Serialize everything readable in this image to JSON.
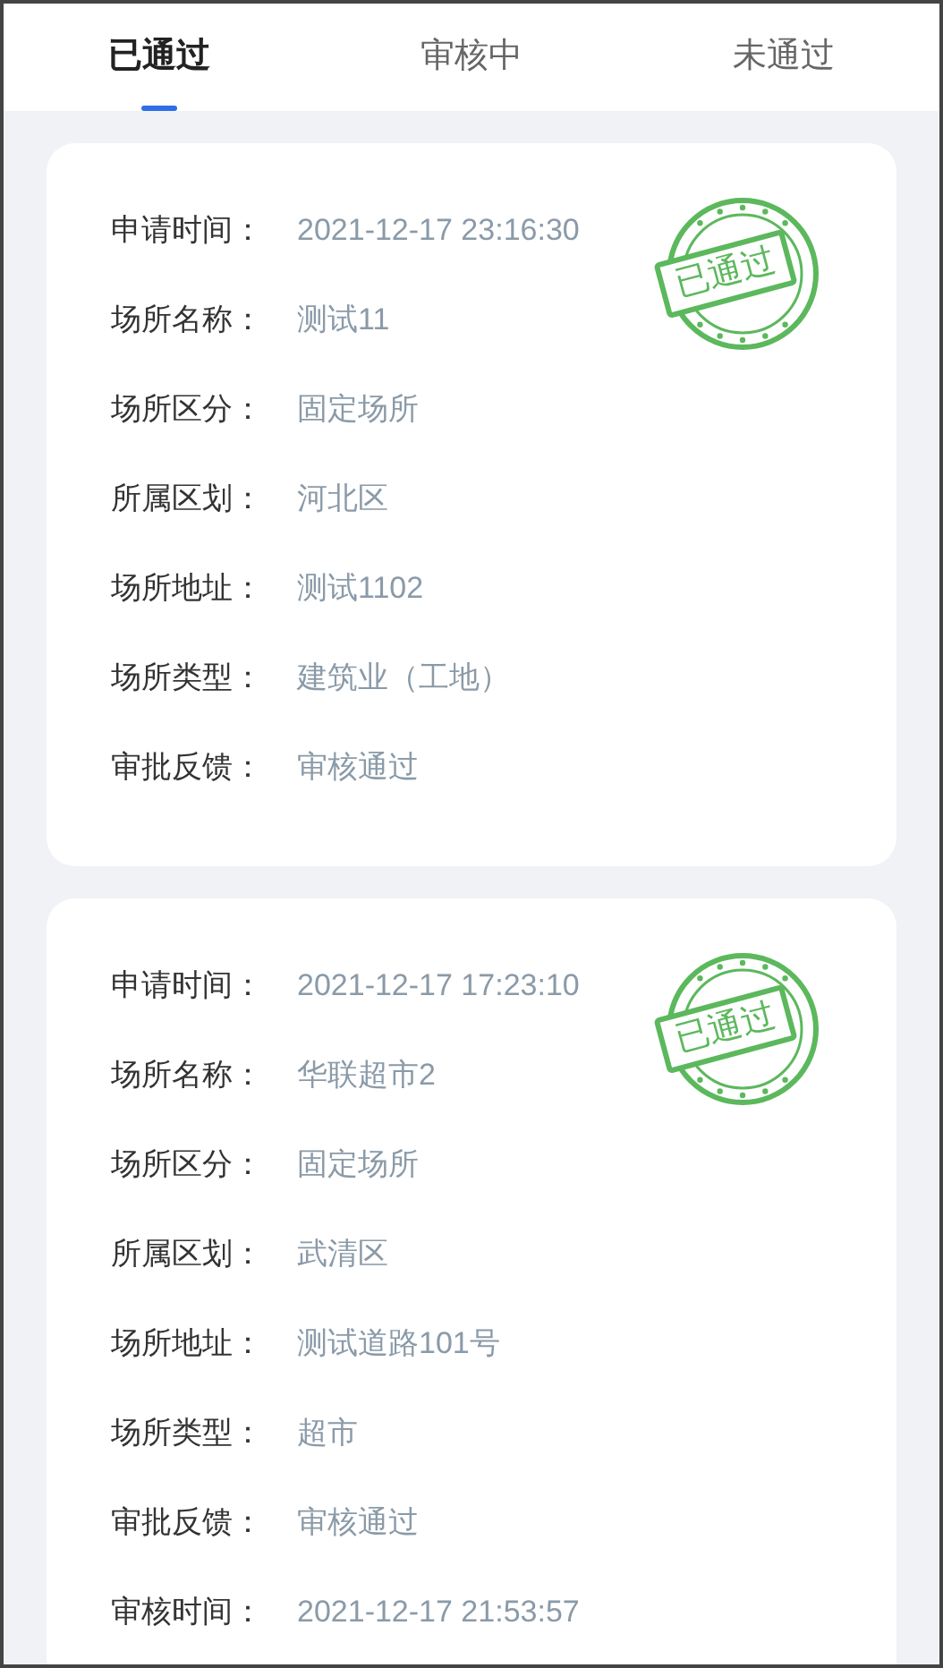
{
  "tabs": [
    {
      "label": "已通过",
      "selected": true
    },
    {
      "label": "审核中",
      "selected": false
    },
    {
      "label": "未通过",
      "selected": false
    }
  ],
  "records": [
    {
      "stamp": "已通过",
      "fields": [
        {
          "label": "申请时间：",
          "value": "2021-12-17 23:16:30"
        },
        {
          "label": "场所名称：",
          "value": "测试11"
        },
        {
          "label": "场所区分：",
          "value": "固定场所"
        },
        {
          "label": "所属区划：",
          "value": "河北区"
        },
        {
          "label": "场所地址：",
          "value": "测试1102"
        },
        {
          "label": "场所类型：",
          "value": "建筑业（工地）"
        },
        {
          "label": "审批反馈：",
          "value": "审核通过"
        }
      ]
    },
    {
      "stamp": "已通过",
      "fields": [
        {
          "label": "申请时间：",
          "value": "2021-12-17 17:23:10"
        },
        {
          "label": "场所名称：",
          "value": "华联超市2"
        },
        {
          "label": "场所区分：",
          "value": "固定场所"
        },
        {
          "label": "所属区划：",
          "value": "武清区"
        },
        {
          "label": "场所地址：",
          "value": "测试道路101号"
        },
        {
          "label": "场所类型：",
          "value": "超市"
        },
        {
          "label": "审批反馈：",
          "value": "审核通过"
        },
        {
          "label": "审核时间：",
          "value": "2021-12-17 21:53:57"
        }
      ]
    }
  ]
}
